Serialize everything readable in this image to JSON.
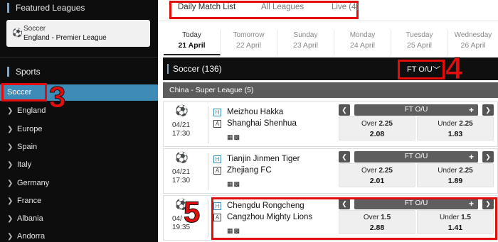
{
  "sidebar": {
    "featured_title": "Featured Leagues",
    "featured": {
      "sport": "Soccer",
      "league": "England - Premier League"
    },
    "sports_title": "Sports",
    "active_sport": "Soccer",
    "countries": [
      "England",
      "Europe",
      "Spain",
      "Italy",
      "Germany",
      "France",
      "Albania",
      "Andorra"
    ]
  },
  "tabs": [
    {
      "label": "Daily Match List",
      "active": true
    },
    {
      "label": "All Leagues",
      "active": false
    },
    {
      "label": "Live (4)",
      "active": false
    }
  ],
  "days": [
    {
      "name": "Today",
      "date": "21 April",
      "active": true
    },
    {
      "name": "Tomorrow",
      "date": "22 April",
      "active": false
    },
    {
      "name": "Sunday",
      "date": "23 April",
      "active": false
    },
    {
      "name": "Monday",
      "date": "24 April",
      "active": false
    },
    {
      "name": "Tuesday",
      "date": "25 April",
      "active": false
    },
    {
      "name": "Wednesday",
      "date": "26 April",
      "active": false
    }
  ],
  "sport_bar": {
    "label": "Soccer (136)",
    "market_select": "FT O/U",
    "chevron": "chevron-down-icon"
  },
  "league": "China - Super League (5)",
  "annotations": [
    "3",
    "4",
    "5"
  ],
  "matches": [
    {
      "date": "04/21",
      "time": "17:30",
      "home_tag": "H",
      "away_tag": "A",
      "home": "Meizhou Hakka",
      "away": "Shanghai Shenhua",
      "market": "FT O/U",
      "over_label": "Over",
      "over_line": "2.25",
      "over_odds": "2.08",
      "under_label": "Under",
      "under_line": "2.25",
      "under_odds": "1.83"
    },
    {
      "date": "04/21",
      "time": "17:30",
      "home_tag": "H",
      "away_tag": "A",
      "home": "Tianjin Jinmen Tiger",
      "away": "Zhejiang FC",
      "market": "FT O/U",
      "over_label": "Over",
      "over_line": "2.25",
      "over_odds": "2.01",
      "under_label": "Under",
      "under_line": "2.25",
      "under_odds": "1.89"
    },
    {
      "date": "04/",
      "time": "19:35",
      "home_tag": "H",
      "away_tag": "A",
      "home": "Chengdu Rongcheng",
      "away": "Cangzhou Mighty Lions",
      "market": "FT O/U",
      "over_label": "Over",
      "over_line": "1.5",
      "over_odds": "2.88",
      "under_label": "Under",
      "under_line": "1.5",
      "under_odds": "1.41"
    }
  ],
  "colors": {
    "accent": "#3e8bb8",
    "highlight": "#e40d0d",
    "dark": "#0d0d0d"
  }
}
